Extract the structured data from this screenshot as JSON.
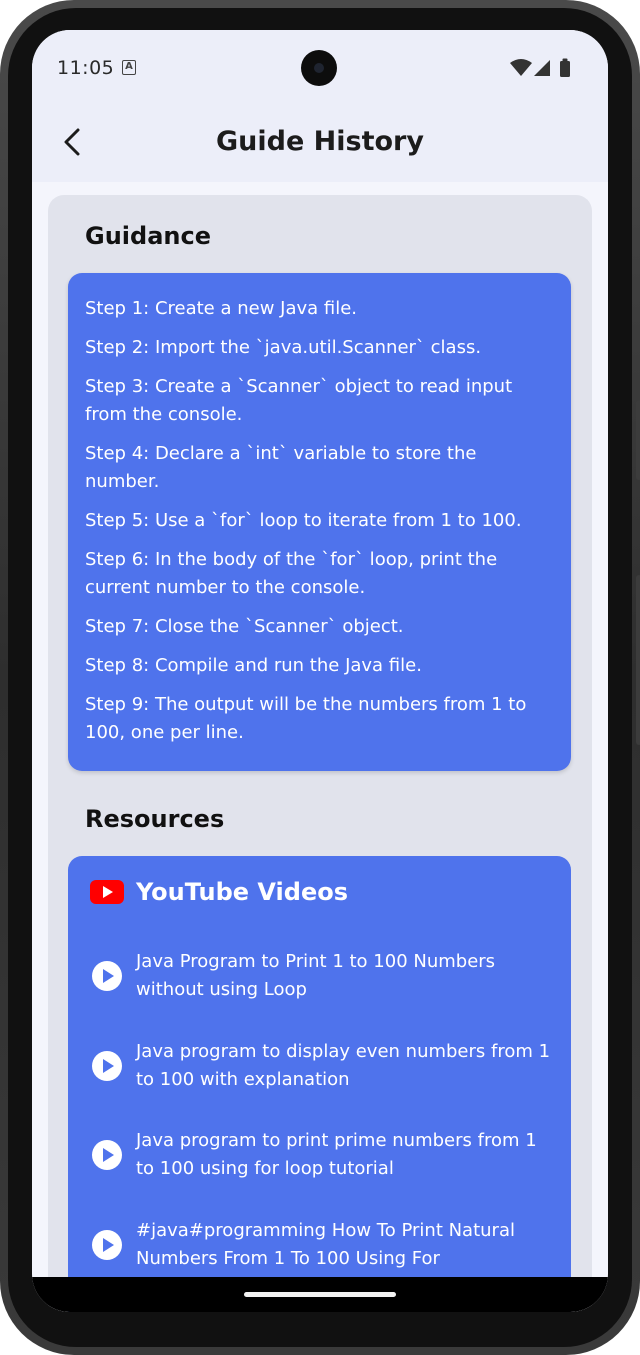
{
  "status_bar": {
    "time": "11:05",
    "notification_icon": "A",
    "icons": [
      "wifi-icon",
      "signal-icon",
      "battery-icon"
    ]
  },
  "header": {
    "title": "Guide History",
    "back_icon": "chevron-left-icon"
  },
  "guidance": {
    "title": "Guidance",
    "steps": [
      "Step 1: Create a new Java file.",
      "Step 2: Import the `java.util.Scanner` class.",
      "Step 3: Create a `Scanner` object to read input from the console.",
      "Step 4: Declare a `int` variable to store the number.",
      "Step 5: Use a `for` loop to iterate from 1 to 100.",
      "Step 6: In the body of the `for` loop, print the current number to the console.",
      "Step 7: Close the `Scanner` object.",
      "Step 8: Compile and run the Java file.",
      "Step 9: The output will be the numbers from 1 to 100, one per line."
    ]
  },
  "resources": {
    "title": "Resources",
    "youtube": {
      "title": "YouTube Videos",
      "videos": [
        "Java Program to Print 1 to 100 Numbers without using Loop",
        "Java program to display even numbers from 1 to 100 with explanation",
        "Java program to print prime numbers from 1 to 100 using for loop tutorial",
        "#java#programming How To Print Natural Numbers From 1 To 100 Using For"
      ]
    }
  },
  "colors": {
    "card": "#4f73ec",
    "content_bg": "#e1e3ec",
    "app_bar": "#eceef9",
    "youtube_red": "#ff0000"
  }
}
